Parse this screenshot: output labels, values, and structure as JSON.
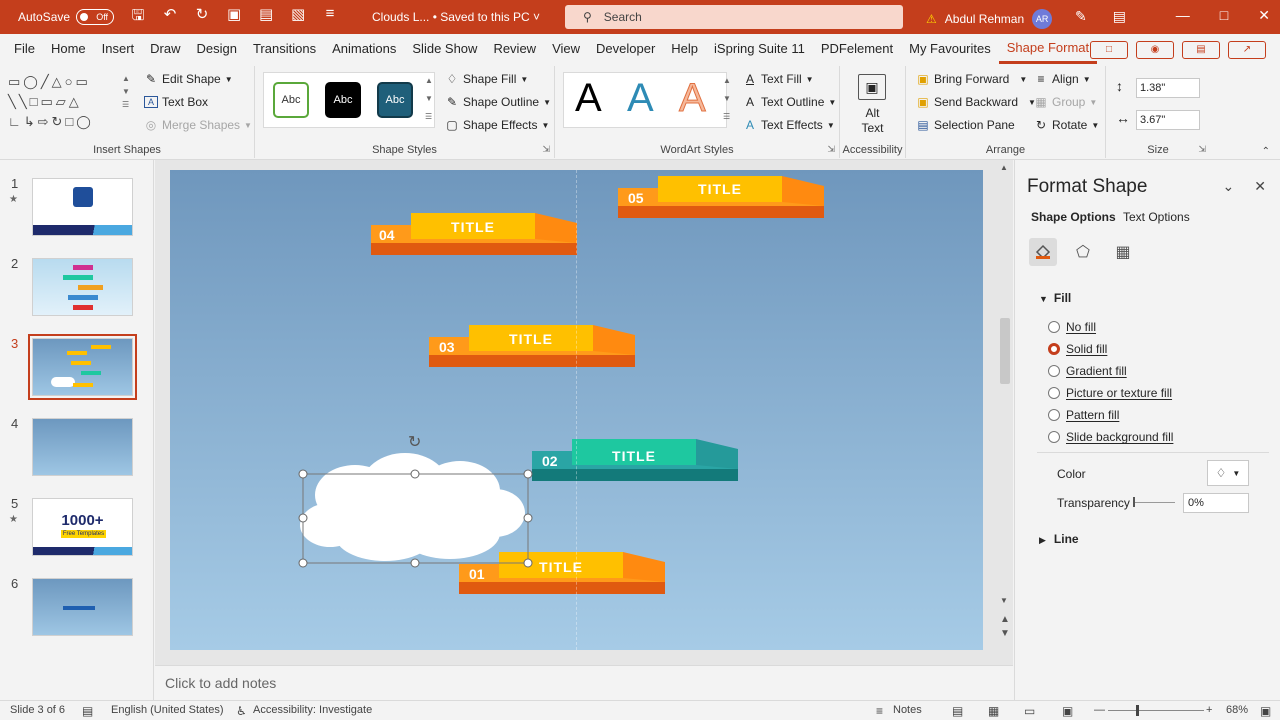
{
  "titlebar": {
    "autosave_label": "AutoSave",
    "autosave_state": "Off",
    "file_name": "Clouds L... • Saved to this PC ˅",
    "search_placeholder": "Search",
    "user_name": "Abdul Rehman",
    "user_initials": "AR"
  },
  "tabs": [
    "File",
    "Home",
    "Insert",
    "Draw",
    "Design",
    "Transitions",
    "Animations",
    "Slide Show",
    "Review",
    "View",
    "Developer",
    "Help",
    "iSpring Suite 11",
    "PDFelement",
    "My Favourites",
    "Shape Format"
  ],
  "active_tab": "Shape Format",
  "ribbon": {
    "insert_shapes": {
      "label": "Insert Shapes",
      "edit_shape": "Edit Shape",
      "text_box": "Text Box",
      "merge_shapes": "Merge Shapes"
    },
    "shape_styles": {
      "label": "Shape Styles",
      "style_sample": "Abc",
      "shape_fill": "Shape Fill",
      "shape_outline": "Shape Outline",
      "shape_effects": "Shape Effects"
    },
    "wordart": {
      "label": "WordArt Styles",
      "letter": "A",
      "text_fill": "Text Fill",
      "text_outline": "Text Outline",
      "text_effects": "Text Effects"
    },
    "accessibility": {
      "label": "Accessibility",
      "alt_text_line1": "Alt",
      "alt_text_line2": "Text"
    },
    "arrange": {
      "label": "Arrange",
      "bring_forward": "Bring Forward",
      "send_backward": "Send Backward",
      "selection_pane": "Selection Pane",
      "align": "Align",
      "group": "Group",
      "rotate": "Rotate"
    },
    "size": {
      "label": "Size",
      "height": "1.38\"",
      "width": "3.67\""
    }
  },
  "slides": [
    {
      "num": "1",
      "star": "★"
    },
    {
      "num": "2",
      "star": ""
    },
    {
      "num": "3",
      "star": ""
    },
    {
      "num": "4",
      "star": ""
    },
    {
      "num": "5",
      "star": "★"
    },
    {
      "num": "6",
      "star": ""
    }
  ],
  "thumb5_text": "1000+",
  "thumb5_sub": "Free Templates",
  "banners": [
    {
      "num": "05",
      "label": "TITLE"
    },
    {
      "num": "04",
      "label": "TITLE"
    },
    {
      "num": "03",
      "label": "TITLE"
    },
    {
      "num": "02",
      "label": "TITLE"
    },
    {
      "num": "01",
      "label": "TITLE"
    }
  ],
  "colors": {
    "accent": "#c43e1c",
    "orange_top": "#ffc000",
    "orange_side": "#ff9a1a",
    "orange_shadow": "#e05a10",
    "teal_top": "#1ec8a0",
    "teal_side": "#2aa5a5",
    "teal_shadow": "#137a7a"
  },
  "notes_placeholder": "Click to add notes",
  "pane": {
    "title": "Format Shape",
    "tab_shape": "Shape Options",
    "tab_text": "Text Options",
    "fill_section": "Fill",
    "fill_options": [
      "No fill",
      "Solid fill",
      "Gradient fill",
      "Picture or texture fill",
      "Pattern fill",
      "Slide background fill"
    ],
    "selected_fill": "Solid fill",
    "color_label": "Color",
    "transparency_label": "Transparency",
    "transparency_value": "0%",
    "line_section": "Line"
  },
  "status": {
    "slide_info": "Slide 3 of 6",
    "language": "English (United States)",
    "accessibility": "Accessibility: Investigate",
    "notes": "Notes",
    "zoom": "68%"
  }
}
